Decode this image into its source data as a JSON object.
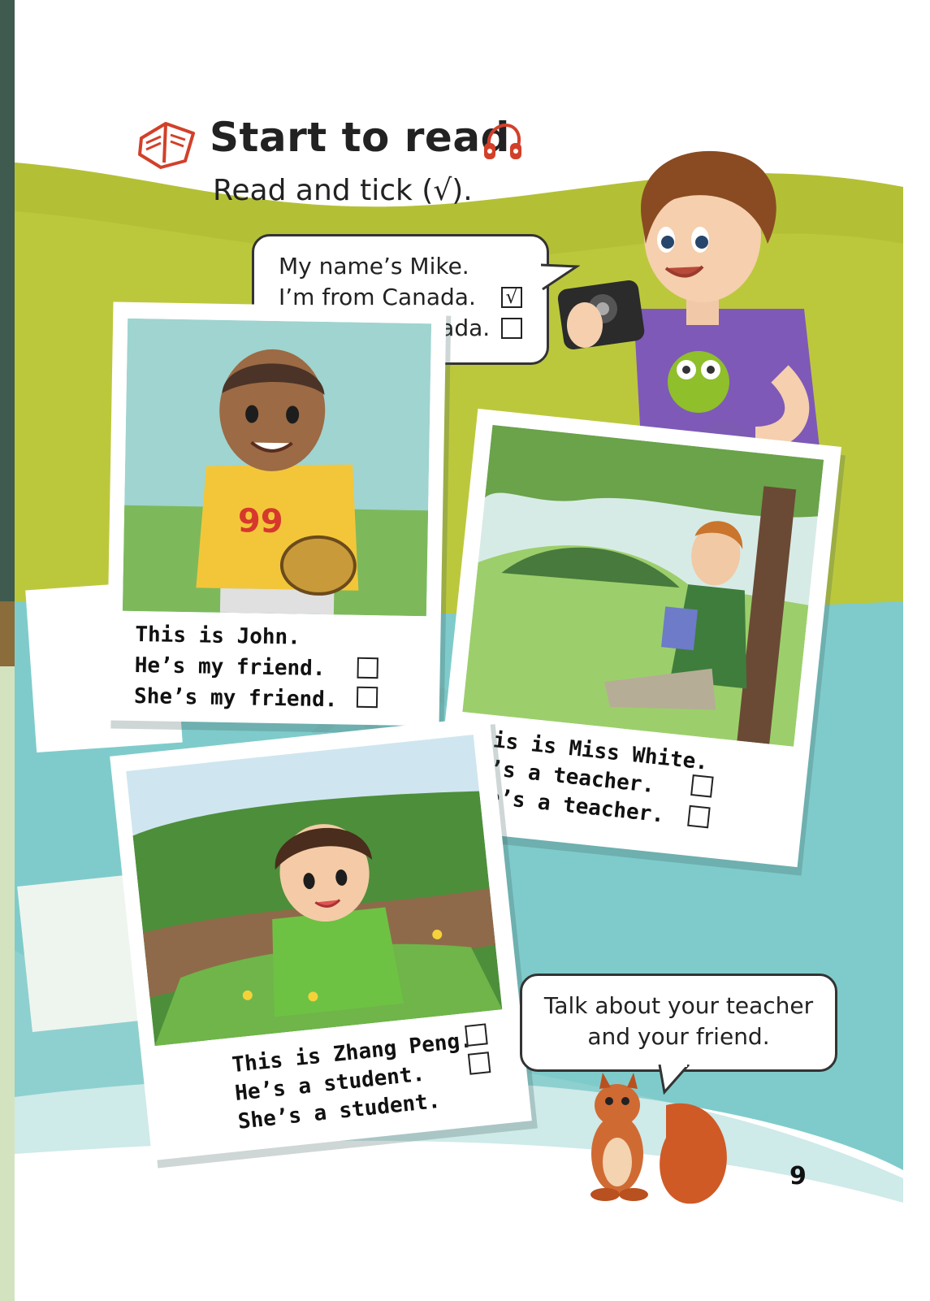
{
  "header": {
    "title": "Start to read",
    "instruction": "Read and tick (√).",
    "book_icon": "open-book-icon",
    "headphones_icon": "headphones-icon"
  },
  "mike_bubble": {
    "lines": [
      "My name’s Mike.",
      "I’m from Canada.",
      "He’s from Canada."
    ],
    "ticks": [
      "√",
      ""
    ]
  },
  "photos": {
    "john": {
      "lines": [
        "This is John.",
        "He’s my friend.",
        "She’s my friend."
      ],
      "shirt_number": "99"
    },
    "miss_white": {
      "lines": [
        "This is Miss White.",
        "He’s a teacher.",
        "She’s a teacher."
      ]
    },
    "zhang_peng": {
      "lines": [
        "This is Zhang Peng.",
        "He’s a student.",
        "She’s a student."
      ]
    }
  },
  "talk_bubble": {
    "lines": [
      "Talk about your teacher",
      "and your friend."
    ]
  },
  "page_number": "9",
  "colors": {
    "green_band": "#bcc83c",
    "teal_band": "#7fcbcb",
    "accent_red": "#d2402a",
    "side_bar": "#3f5a4e"
  }
}
